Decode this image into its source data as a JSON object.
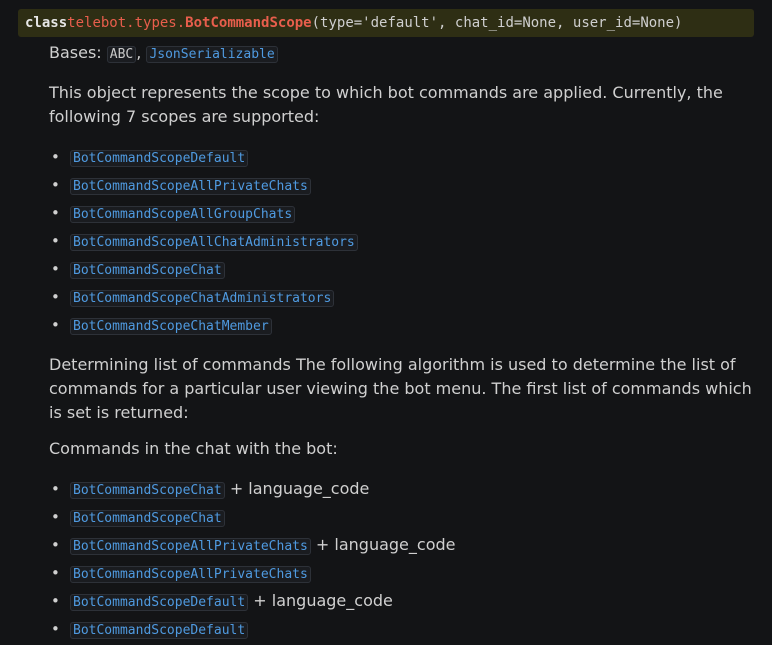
{
  "signature": {
    "keyword": "class",
    "module": "telebot.types.",
    "class_name": "BotCommandScope",
    "params": "(type='default', chat_id=None, user_id=None)"
  },
  "bases": {
    "label": "Bases:",
    "items": [
      "ABC",
      "JsonSerializable"
    ],
    "separator": ","
  },
  "intro": "This object represents the scope to which bot commands are applied. Currently, the following 7 scopes are supported:",
  "scopes": [
    "BotCommandScopeDefault",
    "BotCommandScopeAllPrivateChats",
    "BotCommandScopeAllGroupChats",
    "BotCommandScopeAllChatAdministrators",
    "BotCommandScopeChat",
    "BotCommandScopeChatAdministrators",
    "BotCommandScopeChatMember"
  ],
  "algorithm_text": "Determining list of commands The following algorithm is used to determine the list of commands for a particular user viewing the bot menu. The first list of commands which is set is returned:",
  "commands_heading": "Commands in the chat with the bot:",
  "commands": [
    {
      "scope": "BotCommandScopeChat",
      "suffix": "+ language_code"
    },
    {
      "scope": "BotCommandScopeChat",
      "suffix": ""
    },
    {
      "scope": "BotCommandScopeAllPrivateChats",
      "suffix": "+ language_code"
    },
    {
      "scope": "BotCommandScopeAllPrivateChats",
      "suffix": ""
    },
    {
      "scope": "BotCommandScopeDefault",
      "suffix": "+ language_code"
    },
    {
      "scope": "BotCommandScopeDefault",
      "suffix": ""
    }
  ],
  "bullet_glyph": "•",
  "colors": {
    "background": "#131416",
    "signature_bg": "#2e2e14",
    "link": "#4f9ae0",
    "class_name": "#e85e4c"
  }
}
